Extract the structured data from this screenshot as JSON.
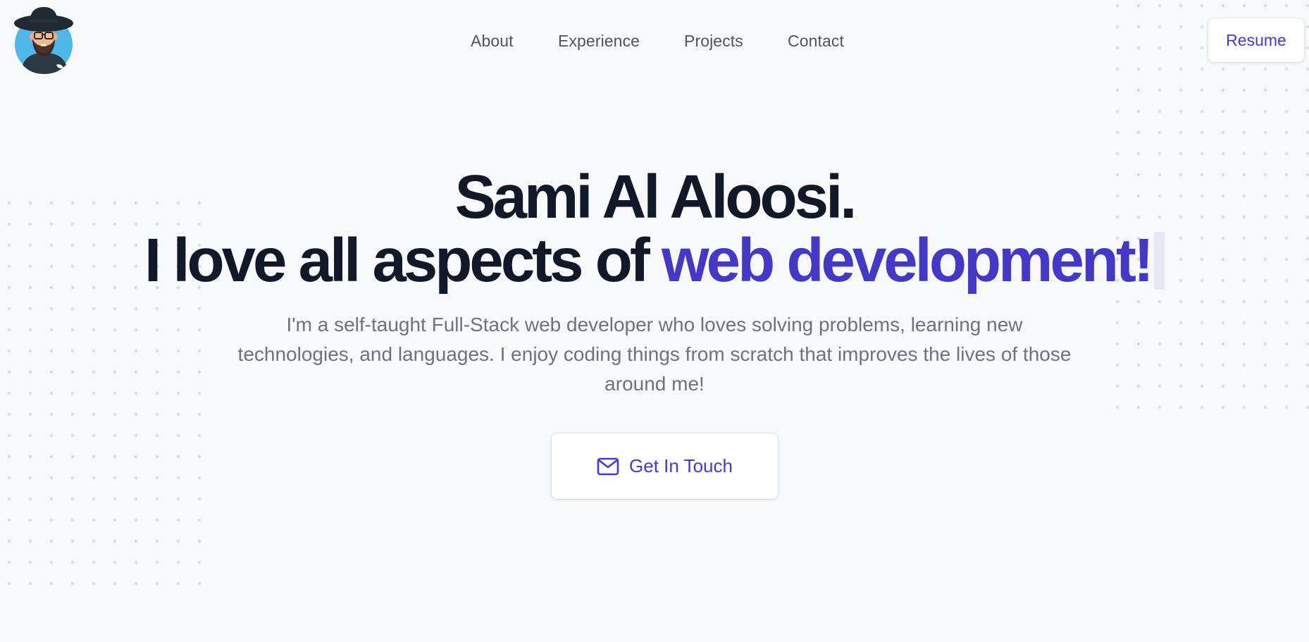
{
  "header": {
    "avatar_label": "",
    "nav": [
      {
        "label": "About"
      },
      {
        "label": "Experience"
      },
      {
        "label": "Projects"
      },
      {
        "label": "Contact"
      }
    ],
    "resume_label": "Resume"
  },
  "hero": {
    "name": "Sami Al Aloosi.",
    "tagline_prefix": "I love all aspects of ",
    "tagline_accent": "web development!",
    "intro": "I'm a self-taught Full-Stack web developer who loves solving problems, learning new technologies, and languages. I enjoy coding things from scratch that improves the lives of those around me!",
    "cta_label": "Get In Touch",
    "cta_icon": "mail-icon"
  },
  "colors": {
    "accent": "#4338ca",
    "heading": "#111827",
    "body_text": "#6b7280",
    "nav_text": "#4b5563",
    "background": "#f8f9fb"
  }
}
